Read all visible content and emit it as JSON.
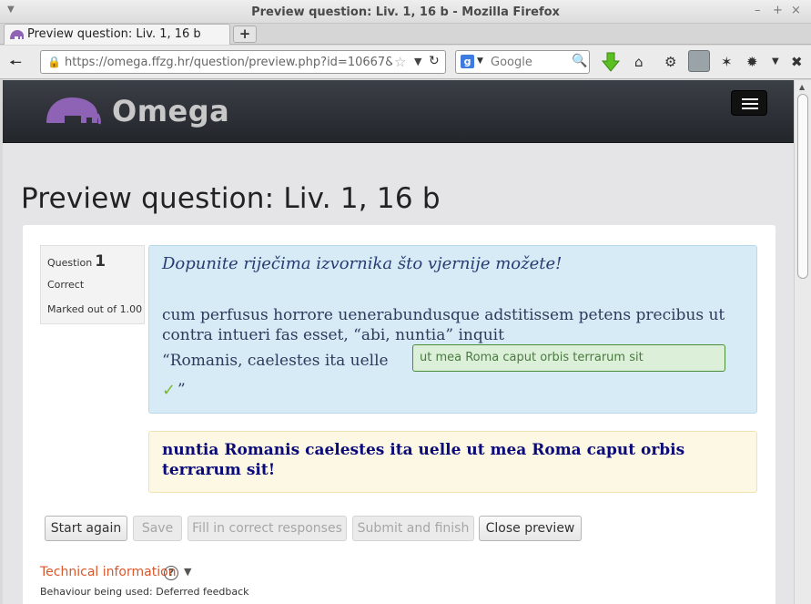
{
  "window": {
    "title": "Preview question: Liv. 1, 16 b - Mozilla Firefox",
    "controls": [
      "–",
      "+",
      "×"
    ]
  },
  "tab": {
    "title": "Preview question: Liv. 1, 16 b",
    "new_tab": "+"
  },
  "nav": {
    "url": "https://omega.ffzg.hr/question/preview.php?id=10667&pre",
    "search_engine": "Google"
  },
  "site": {
    "brand": "Omega",
    "colors": {
      "header": "#2b2e33",
      "logo": "#8e62b5"
    }
  },
  "page": {
    "title": "Preview question: Liv. 1, 16 b"
  },
  "question": {
    "label": "Question",
    "number": "1",
    "state": "Correct",
    "grade": "Marked out of 1.00",
    "instruction": "Dopunite riječima izvornika što vjernije možete!",
    "text_line1": "cum perfusus horrore uenerabundusque adstitissem petens precibus ut contra intueri fas esset, “abi, nuntia” inquit",
    "text_line3": "“Romanis, caelestes ita uelle",
    "answer": "ut mea Roma caput orbis terrarum sit",
    "closing_quote": "”",
    "right_answer": "nuntia Romanis caelestes ita uelle ut mea Roma caput orbis terrarum sit!"
  },
  "buttons": {
    "start_again": "Start again",
    "save": "Save",
    "fill_correct": "Fill in correct responses",
    "submit_finish": "Submit and finish",
    "close_preview": "Close preview"
  },
  "tech": {
    "link": "Technical information",
    "behaviour": "Behaviour being used: Deferred feedback"
  }
}
